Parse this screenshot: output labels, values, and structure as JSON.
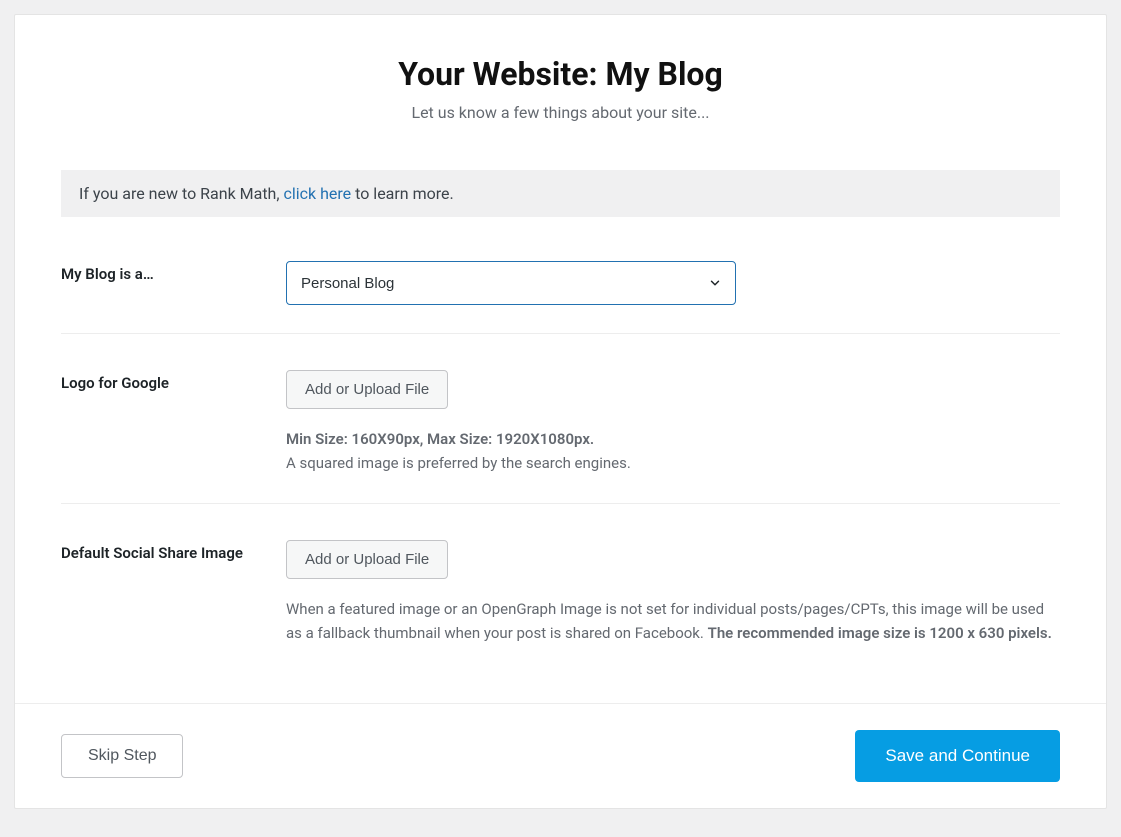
{
  "header": {
    "title": "Your Website: My Blog",
    "subtitle": "Let us know a few things about your site..."
  },
  "infobox": {
    "prefix": "If you are new to Rank Math, ",
    "link": "click here",
    "suffix": " to learn more."
  },
  "form": {
    "site_type": {
      "label": "My Blog is a…",
      "selected": "Personal Blog"
    },
    "logo": {
      "label": "Logo for Google",
      "button": "Add or Upload File",
      "help_strong": "Min Size: 160X90px, Max Size: 1920X1080px.",
      "help_text": "A squared image is preferred by the search engines."
    },
    "social": {
      "label": "Default Social Share Image",
      "button": "Add or Upload File",
      "help_prefix": "When a featured image or an OpenGraph Image is not set for individual posts/pages/CPTs, this image will be used as a fallback thumbnail when your post is shared on Facebook. ",
      "help_strong": "The recommended image size is 1200 x 630 pixels."
    }
  },
  "footer": {
    "skip": "Skip Step",
    "save": "Save and Continue"
  }
}
